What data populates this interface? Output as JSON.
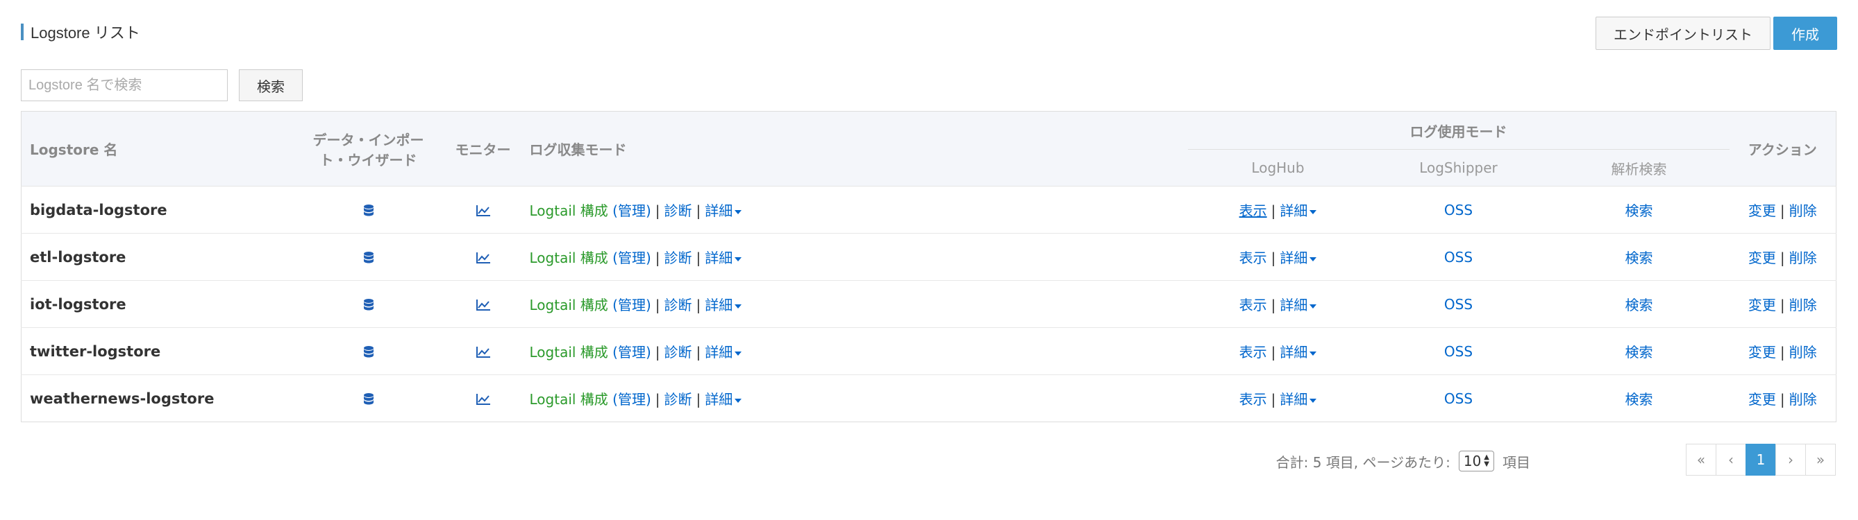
{
  "header": {
    "title": "Logstore リスト",
    "endpoint_list_label": "エンドポイントリスト",
    "create_label": "作成"
  },
  "search": {
    "placeholder": "Logstore 名で検索",
    "button_label": "検索"
  },
  "table": {
    "headers": {
      "name": "Logstore 名",
      "import_wizard": "データ・インポート・ウイザード",
      "monitor": "モニター",
      "collection_mode": "ログ収集モード",
      "usage_mode": "ログ使用モード",
      "loghub": "LogHub",
      "logshipper": "LogShipper",
      "analysis": "解析検索",
      "actions": "アクション"
    },
    "rows": [
      {
        "name": "bigdata-logstore",
        "logtail": "Logtail 構成",
        "manage": "(管理)",
        "diagnose": "診断",
        "detail": "詳細",
        "view": "表示",
        "view_detail": "詳細",
        "oss": "OSS",
        "search": "検索",
        "edit": "変更",
        "delete": "削除"
      },
      {
        "name": "etl-logstore",
        "logtail": "Logtail 構成",
        "manage": "(管理)",
        "diagnose": "診断",
        "detail": "詳細",
        "view": "表示",
        "view_detail": "詳細",
        "oss": "OSS",
        "search": "検索",
        "edit": "変更",
        "delete": "削除"
      },
      {
        "name": "iot-logstore",
        "logtail": "Logtail 構成",
        "manage": "(管理)",
        "diagnose": "診断",
        "detail": "詳細",
        "view": "表示",
        "view_detail": "詳細",
        "oss": "OSS",
        "search": "検索",
        "edit": "変更",
        "delete": "削除"
      },
      {
        "name": "twitter-logstore",
        "logtail": "Logtail 構成",
        "manage": "(管理)",
        "diagnose": "診断",
        "detail": "詳細",
        "view": "表示",
        "view_detail": "詳細",
        "oss": "OSS",
        "search": "検索",
        "edit": "変更",
        "delete": "削除"
      },
      {
        "name": "weathernews-logstore",
        "logtail": "Logtail 構成",
        "manage": "(管理)",
        "diagnose": "診断",
        "detail": "詳細",
        "view": "表示",
        "view_detail": "詳細",
        "oss": "OSS",
        "search": "検索",
        "edit": "変更",
        "delete": "削除"
      }
    ],
    "separator": "|"
  },
  "icons": {
    "import": "database-icon",
    "monitor": "line-chart-icon"
  },
  "pagination": {
    "summary": "合計: 5 項目, ページあたり:",
    "per_page": "10",
    "items_suffix": "項目",
    "first": "«",
    "prev": "‹",
    "current": "1",
    "next": "›",
    "last": "»"
  },
  "colors": {
    "accent": "#3c9ad5",
    "link": "#0066cc",
    "logtail_green": "#2b9a2b",
    "header_bg": "#f4f6fa"
  }
}
